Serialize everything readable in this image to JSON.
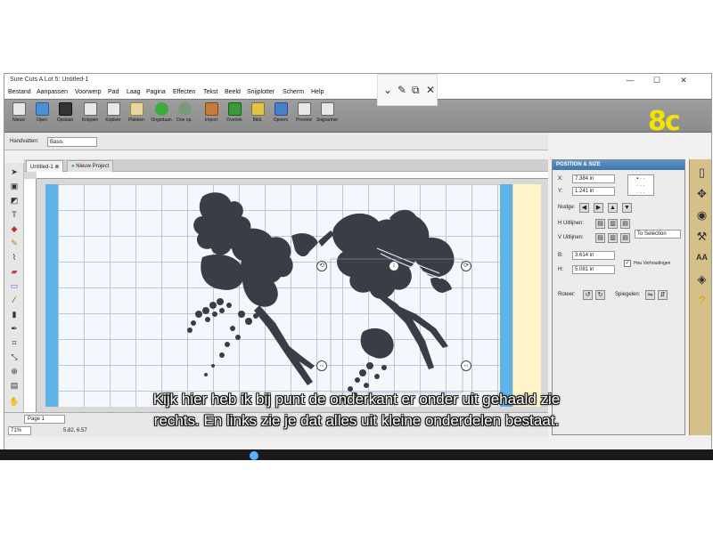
{
  "window": {
    "title": "Sure Cuts A Lot 5: Untitled-1",
    "controls": [
      "—",
      "☐",
      "✕"
    ]
  },
  "menu": [
    "Bestand",
    "Aanpassen",
    "Voorwerp",
    "Pad",
    "Laag",
    "Pagina",
    "Effecten",
    "Tekst",
    "Beeld",
    "Snijplotter",
    "Scherm",
    "Help"
  ],
  "popup_tools": {
    "pin": "⌄",
    "pen": "✎",
    "copy": "⧉",
    "close": "✕"
  },
  "toolbar": [
    {
      "label": "Nieuw",
      "color": "#e8e8e8"
    },
    {
      "label": "Open",
      "color": "#4a8fd9"
    },
    {
      "label": "Opslaan",
      "color": "#333333"
    },
    {
      "label": "Knippen",
      "color": "#e8e8e8"
    },
    {
      "label": "Kopieer",
      "color": "#e8e8e8"
    },
    {
      "label": "Plakken",
      "color": "#e8d79a"
    },
    {
      "label": "Ongedaan",
      "color": "#3caa3c"
    },
    {
      "label": "Doe op.",
      "color": "#3caa3c"
    },
    {
      "label": "Import",
      "color": "#c97a3a"
    },
    {
      "label": "Overlek",
      "color": "#3a9a3a"
    },
    {
      "label": "Bibli.",
      "color": "#e0c44a"
    },
    {
      "label": "Opnem",
      "color": "#4a7fc9"
    },
    {
      "label": "Preview",
      "color": "#e8e8e8"
    },
    {
      "label": "Snijpartner",
      "color": "#e8e8e8"
    }
  ],
  "logo": "8c",
  "handbar": {
    "label": "Handvatten:",
    "value": "Basis"
  },
  "doc_tabs": [
    "Untitled-1",
    "Nieuw Project"
  ],
  "status": {
    "page_tab": "Page 1",
    "zoom": "71%",
    "coords": "5.82, 6.57"
  },
  "panel": {
    "title": "POSITION & SIZE",
    "x_label": "X:",
    "x_value": "7.384 in",
    "y_label": "Y:",
    "y_value": "1.241 in",
    "nudge_label": "Nudge:",
    "h_align_label": "H Uitlijnen:",
    "v_align_label": "V Uitlijnen:",
    "align_select": "To Selection",
    "w_label": "B:",
    "w_value": "3.614 in",
    "h_label": "H:",
    "h_value": "5.081 in",
    "keep_ratio_label": "Hou Verhoudingen",
    "rotate_label": "Roteer:",
    "mirror_label": "Spiegelen:"
  },
  "subtitle": {
    "line1": "Kijk hier heb ik bij punt de onderkant er onder uit gehaald zie",
    "line2": "rechts. En links zie je dat alles uit kleine onderdelen bestaat."
  }
}
